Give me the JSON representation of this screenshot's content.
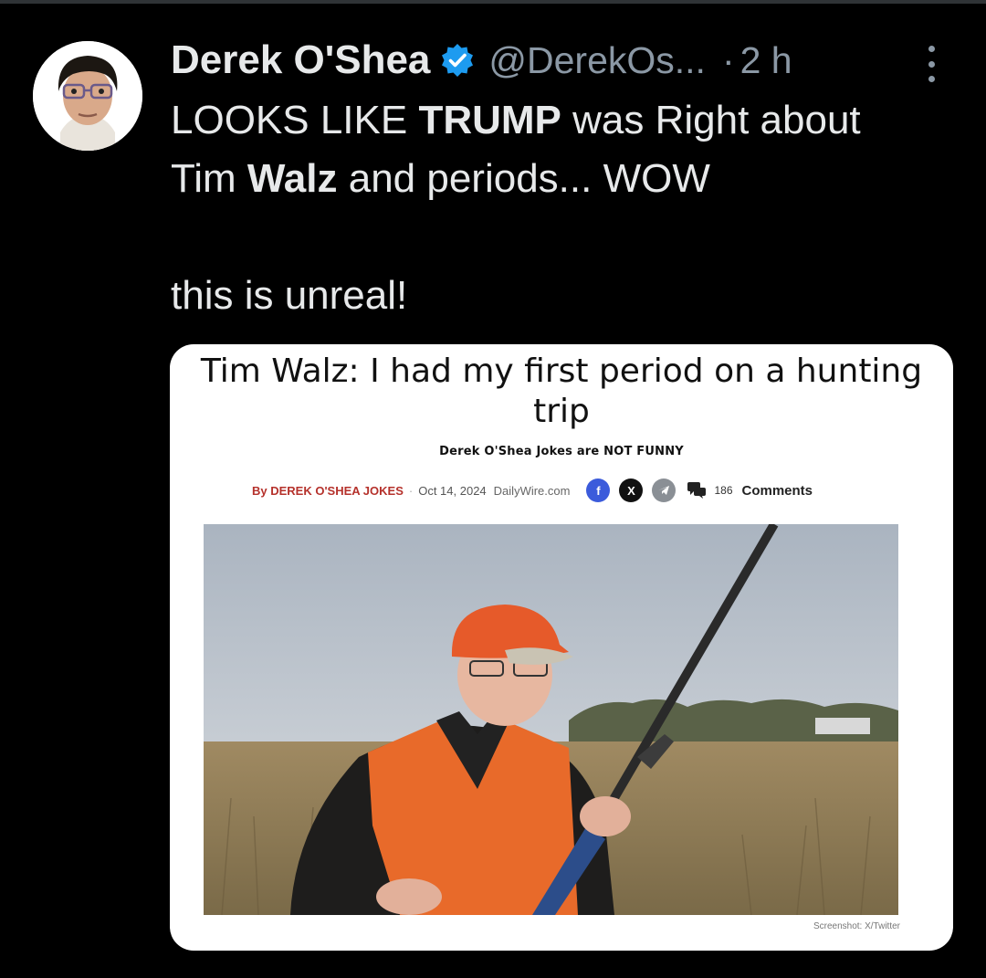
{
  "post": {
    "author_name": "Derek O'Shea",
    "handle": "@DerekOs...",
    "separator": "·",
    "time": "2 h",
    "text_lines": [
      [
        {
          "t": "LOOKS LIKE ",
          "b": false
        },
        {
          "t": "TRUMP",
          "b": true
        },
        {
          "t": " was Right about",
          "b": false
        }
      ],
      [
        {
          "t": "Tim ",
          "b": false
        },
        {
          "t": "Walz",
          "b": true
        },
        {
          "t": " and periods... WOW",
          "b": false
        }
      ],
      [],
      [
        {
          "t": "this is unreal!",
          "b": false
        }
      ]
    ]
  },
  "article": {
    "headline_line1": "Tim Walz: I had my first period on a hunting",
    "headline_line2": "trip",
    "subhead": "Derek O'Shea Jokes are NOT FUNNY",
    "byline": "By  DEREK O'SHEA JOKES",
    "date": "Oct 14, 2024",
    "site": "DailyWire.com",
    "share_fb": "f",
    "share_x": "X",
    "comment_count": "186",
    "comments_label": "Comments",
    "photo_credit": "Screenshot: X/Twitter"
  },
  "colors": {
    "background": "#000000",
    "text": "#e7e9ea",
    "muted": "#8b98a5",
    "verified": "#1d9bf0",
    "byline_red": "#b5312b"
  },
  "icons": [
    "verified-badge-icon",
    "more-options-icon",
    "facebook-icon",
    "x-icon",
    "telegram-icon",
    "comments-icon"
  ]
}
